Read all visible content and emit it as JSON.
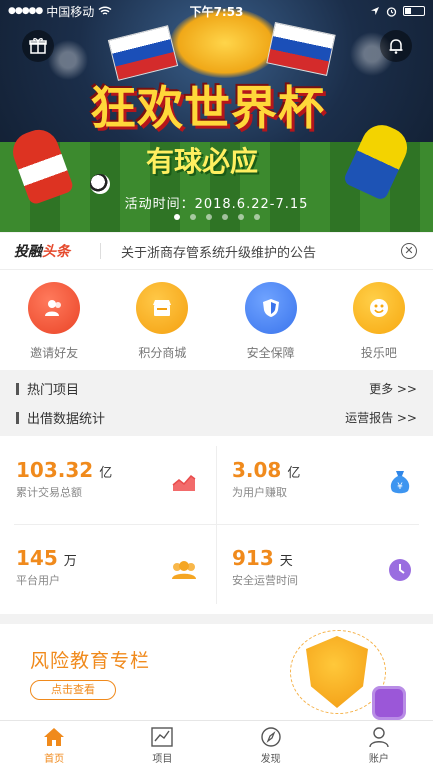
{
  "status_bar": {
    "carrier": "中国移动",
    "time": "下午7:53",
    "signal_icon": "signal-dots-icon",
    "wifi_icon": "wifi-icon",
    "location_icon": "location-arrow-icon",
    "alarm_icon": "alarm-icon",
    "battery_icon": "battery-icon"
  },
  "banner": {
    "headline": "狂欢世界杯",
    "subheadline": "有球必应",
    "date_text": "活动时间：2018.6.22-7.15",
    "page_count": 6,
    "active_page": 1
  },
  "notice": {
    "brand_a": "投融",
    "brand_b": "头条",
    "text": "关于浙商存管系统升级维护的公告",
    "close_icon": "close-icon"
  },
  "quick_menu": [
    {
      "label": "邀请好友",
      "icon": "users-icon",
      "color": "#ea4427"
    },
    {
      "label": "积分商城",
      "icon": "store-icon",
      "color": "#f4a010"
    },
    {
      "label": "安全保障",
      "icon": "shield-icon",
      "color": "#3a74ec"
    },
    {
      "label": "投乐吧",
      "icon": "smiley-icon",
      "color": "#f7a810"
    }
  ],
  "sections": {
    "hot": {
      "title": "热门项目",
      "more": "更多 >>"
    },
    "stats": {
      "title": "出借数据统计",
      "more": "运营报告 >>"
    }
  },
  "stats": [
    {
      "value": "103.32",
      "unit": "亿",
      "caption": "累计交易总额",
      "icon": "trend-chart-icon"
    },
    {
      "value": "3.08",
      "unit": "亿",
      "caption": "为用户赚取",
      "icon": "money-bag-icon"
    },
    {
      "value": "145",
      "unit": "万",
      "caption": "平台用户",
      "icon": "users-group-icon"
    },
    {
      "value": "913",
      "unit": "天",
      "caption": "安全运营时间",
      "icon": "clock-icon"
    }
  ],
  "risk": {
    "title": "风险教育专栏",
    "button": "点击查看"
  },
  "tabbar": [
    {
      "label": "首页",
      "icon": "home-icon",
      "active": true
    },
    {
      "label": "项目",
      "icon": "chart-icon",
      "active": false
    },
    {
      "label": "发现",
      "icon": "compass-icon",
      "active": false
    },
    {
      "label": "账户",
      "icon": "user-icon",
      "active": false
    }
  ],
  "colors": {
    "accent": "#f08a1c",
    "notice_highlight": "#e54a2d"
  }
}
